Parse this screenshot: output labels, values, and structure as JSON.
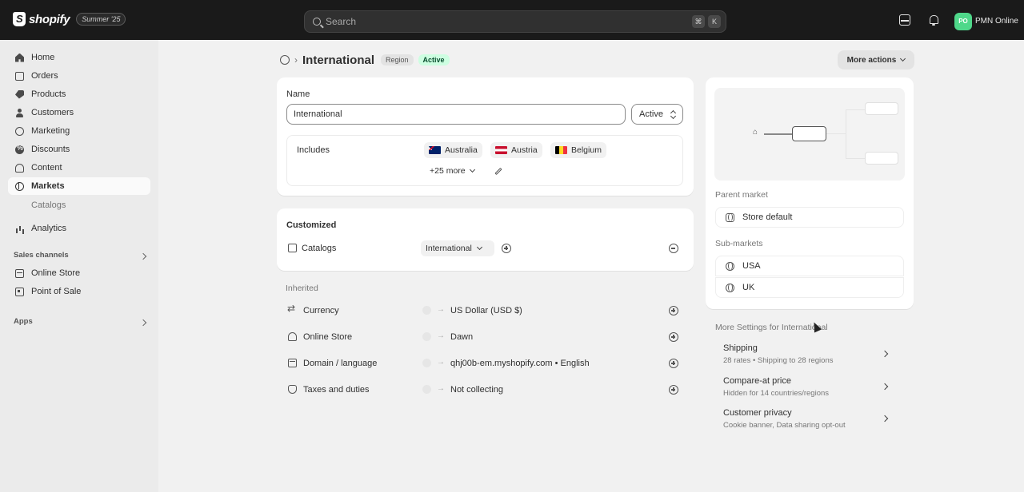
{
  "topbar": {
    "brand": "shopify",
    "edition": "Summer '25",
    "search_placeholder": "Search",
    "shortcut_keys": [
      "⌘",
      "K"
    ],
    "avatar_initials": "PO",
    "store_name": "PMN Online"
  },
  "sidebar": {
    "items": [
      {
        "label": "Home",
        "icon": "home-icon"
      },
      {
        "label": "Orders",
        "icon": "inbox-icon"
      },
      {
        "label": "Products",
        "icon": "tag-icon"
      },
      {
        "label": "Customers",
        "icon": "person-icon"
      },
      {
        "label": "Marketing",
        "icon": "target-icon"
      },
      {
        "label": "Discounts",
        "icon": "discount-icon"
      },
      {
        "label": "Content",
        "icon": "content-icon"
      },
      {
        "label": "Markets",
        "icon": "globe-icon",
        "active": true
      }
    ],
    "markets_sub": "Catalogs",
    "analytics": "Analytics",
    "sales_channels_label": "Sales channels",
    "channels": [
      "Online Store",
      "Point of Sale"
    ],
    "apps_label": "Apps"
  },
  "header": {
    "title": "International",
    "badge_type": "Region",
    "badge_status": "Active",
    "more_actions": "More actions"
  },
  "name_card": {
    "name_label": "Name",
    "name_value": "International",
    "status_value": "Active",
    "includes_label": "Includes",
    "countries": [
      "Australia",
      "Austria",
      "Belgium"
    ],
    "more_countries": "+25 more"
  },
  "customized": {
    "title": "Customized",
    "catalogs_label": "Catalogs",
    "catalogs_value": "International"
  },
  "inherited": {
    "title": "Inherited",
    "rows": [
      {
        "label": "Currency",
        "value": "US Dollar (USD $)"
      },
      {
        "label": "Online Store",
        "value": "Dawn"
      },
      {
        "label": "Domain / language",
        "value": "qhj00b-em.myshopify.com • English"
      },
      {
        "label": "Taxes and duties",
        "value": "Not collecting"
      }
    ]
  },
  "hierarchy": {
    "parent_label": "Parent market",
    "parent_value": "Store default",
    "sub_label": "Sub-markets",
    "subs": [
      "USA",
      "UK"
    ]
  },
  "more_settings": {
    "title": "More Settings for International",
    "items": [
      {
        "title": "Shipping",
        "sub": "28 rates • Shipping to 28 regions"
      },
      {
        "title": "Compare-at price",
        "sub": "Hidden for 14 countries/regions"
      },
      {
        "title": "Customer privacy",
        "sub": "Cookie banner, Data sharing opt-out"
      }
    ]
  }
}
